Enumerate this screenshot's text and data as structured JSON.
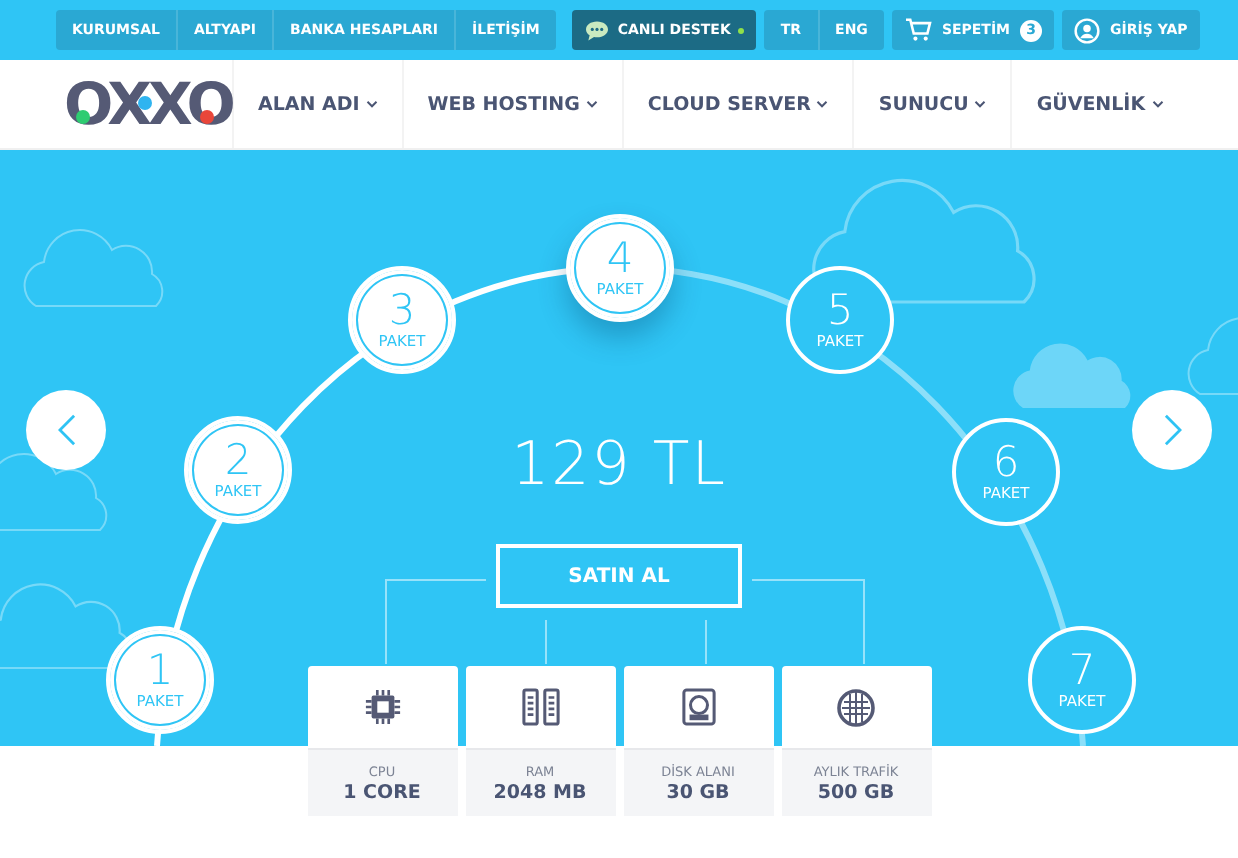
{
  "top_links": [
    {
      "label": "KURUMSAL"
    },
    {
      "label": "ALTYAPI"
    },
    {
      "label": "BANKA HESAPLARI"
    },
    {
      "label": "İLETİŞİM"
    }
  ],
  "live_support": {
    "label": "CANLI DESTEK",
    "online": true
  },
  "languages": [
    {
      "label": "TR"
    },
    {
      "label": "ENG"
    }
  ],
  "cart": {
    "label": "SEPETİM",
    "count": "3"
  },
  "login": {
    "label": "GİRİŞ YAP"
  },
  "logo": "OXXO",
  "nav": [
    {
      "label": "ALAN ADI"
    },
    {
      "label": "WEB HOSTING"
    },
    {
      "label": "CLOUD SERVER"
    },
    {
      "label": "SUNUCU"
    },
    {
      "label": "GÜVENLİK"
    }
  ],
  "packages": [
    {
      "number": "1",
      "label": "PAKET",
      "reached": true,
      "selected": false
    },
    {
      "number": "2",
      "label": "PAKET",
      "reached": true,
      "selected": false
    },
    {
      "number": "3",
      "label": "PAKET",
      "reached": true,
      "selected": false
    },
    {
      "number": "4",
      "label": "PAKET",
      "reached": true,
      "selected": true
    },
    {
      "number": "5",
      "label": "PAKET",
      "reached": false,
      "selected": false
    },
    {
      "number": "6",
      "label": "PAKET",
      "reached": false,
      "selected": false
    },
    {
      "number": "7",
      "label": "PAKET",
      "reached": false,
      "selected": false
    }
  ],
  "price": "129 TL",
  "buy_button": "SATIN AL",
  "specs": [
    {
      "kind": "cpu",
      "label": "CPU",
      "value": "1 CORE"
    },
    {
      "kind": "ram",
      "label": "RAM",
      "value": "2048 MB"
    },
    {
      "kind": "disk",
      "label": "DİSK ALANI",
      "value": "30 GB"
    },
    {
      "kind": "traffic",
      "label": "AYLIK TRAFİK",
      "value": "500 GB"
    }
  ]
}
